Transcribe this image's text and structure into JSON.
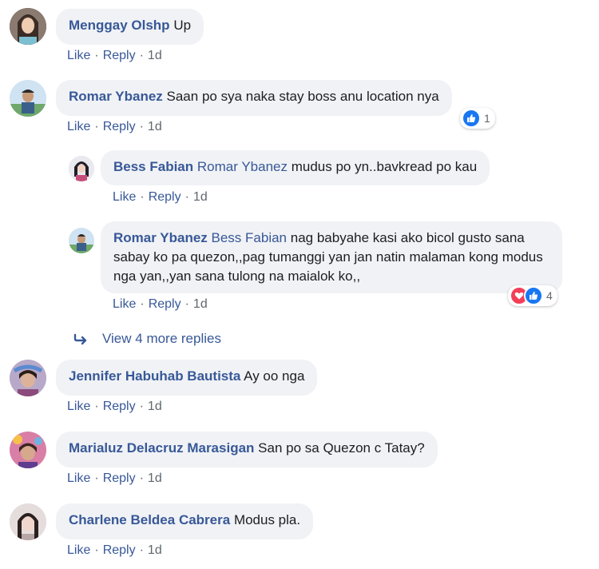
{
  "comments": [
    {
      "author": "Menggay Olshp",
      "text": "Up",
      "actions": {
        "like": "Like",
        "reply": "Reply",
        "time": "1d"
      }
    },
    {
      "author": "Romar Ybanez",
      "text": "Saan po sya naka stay boss anu location nya",
      "actions": {
        "like": "Like",
        "reply": "Reply",
        "time": "1d"
      },
      "reactions": {
        "types": [
          "like-icon"
        ],
        "count": "1"
      }
    },
    {
      "author": "Bess Fabian",
      "mention": "Romar Ybanez",
      "text": "mudus po yn..bavkread po kau",
      "actions": {
        "like": "Like",
        "reply": "Reply",
        "time": "1d"
      }
    },
    {
      "author": "Romar Ybanez",
      "mention": "Bess Fabian",
      "text": "nag babyahe kasi ako bicol gusto sana sabay ko pa quezon,,pag tumanggi yan jan natin malaman kong modus nga yan,,yan sana tulong na maialok ko,,",
      "actions": {
        "like": "Like",
        "reply": "Reply",
        "time": "1d"
      },
      "reactions": {
        "types": [
          "love-icon",
          "like-icon"
        ],
        "count": "4"
      }
    },
    {
      "author": "Jennifer Habuhab Bautista",
      "text": "Ay oo nga",
      "actions": {
        "like": "Like",
        "reply": "Reply",
        "time": "1d"
      }
    },
    {
      "author": "Marialuz Delacruz Marasigan",
      "text": "San po sa Quezon c Tatay?",
      "actions": {
        "like": "Like",
        "reply": "Reply",
        "time": "1d"
      }
    },
    {
      "author": "Charlene Beldea Cabrera",
      "text": "Modus pla.",
      "actions": {
        "like": "Like",
        "reply": "Reply",
        "time": "1d"
      }
    }
  ],
  "view_more": {
    "label": "View 4 more replies",
    "icon": "reply-arrow-icon"
  },
  "colors": {
    "link": "#385898",
    "bubble": "#f0f2f5",
    "like": "#1877f2",
    "love": "#f33e58"
  }
}
